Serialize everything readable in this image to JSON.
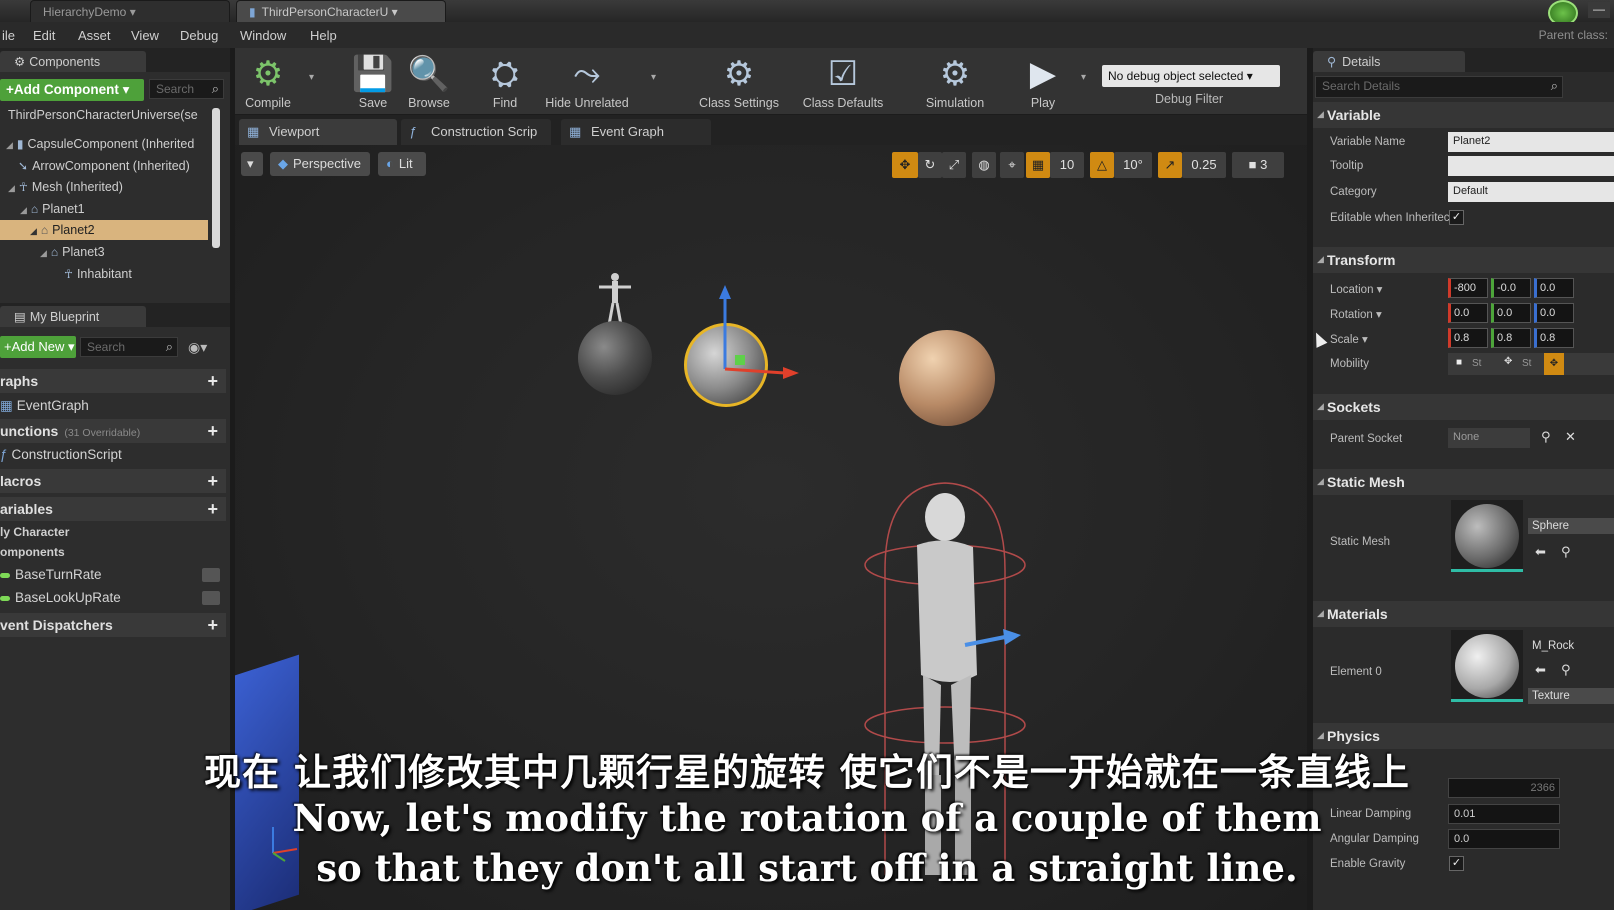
{
  "titlebar": {
    "tabs": [
      "HierarchyDemo",
      "ThirdPersonCharacterU"
    ],
    "parent_class": "Parent class: "
  },
  "menu": [
    "ile",
    "Edit",
    "Asset",
    "View",
    "Debug",
    "Window",
    "Help"
  ],
  "components": {
    "tab": "Components",
    "add_component": "+Add Component ▾",
    "search_placeholder": "Search",
    "root": "ThirdPersonCharacterUniverse(se",
    "tree": [
      {
        "label": "CapsuleComponent (Inherited"
      },
      {
        "label": "ArrowComponent (Inherited)"
      },
      {
        "label": "Mesh (Inherited)"
      },
      {
        "label": "Planet1"
      },
      {
        "label": "Planet2"
      },
      {
        "label": "Planet3"
      },
      {
        "label": "Inhabitant"
      }
    ]
  },
  "myblueprint": {
    "tab": "My Blueprint",
    "add_new": "+Add New ▾",
    "search_placeholder": "Search",
    "graphs_label": "raphs",
    "event_graph": "EventGraph",
    "functions_label": "unctions",
    "functions_note": "(31 Overridable)",
    "construction_script": "ConstructionScript",
    "macros_label": "lacros",
    "variables_label": "ariables",
    "cat_my_character": "ly Character",
    "cat_components": "omponents",
    "vars": [
      "BaseTurnRate",
      "BaseLookUpRate"
    ],
    "event_dispatchers": "vent Dispatchers"
  },
  "toolbar": {
    "compile": "Compile",
    "save": "Save",
    "browse": "Browse",
    "find": "Find",
    "hide_unrelated": "Hide Unrelated",
    "class_settings": "Class Settings",
    "class_defaults": "Class Defaults",
    "simulation": "Simulation",
    "play": "Play",
    "debug_select": "No debug object selected ▾",
    "debug_filter": "Debug Filter"
  },
  "editor_tabs": {
    "viewport": "Viewport",
    "construction": "Construction Scrip",
    "event_graph": "Event Graph"
  },
  "viewport": {
    "perspective": "Perspective",
    "lit": "Lit",
    "grid_snap": "10",
    "rot_snap": "10°",
    "scale_snap": "0.25",
    "cam_speed": "3"
  },
  "subtitles": {
    "chinese": "现在 让我们修改其中几颗行星的旋转 使它们不是一开始就在一条直线上",
    "english_1": "Now, let's modify the rotation of a couple of them",
    "english_2": "so that they don't all start off in a straight line."
  },
  "details": {
    "tab": "Details",
    "search_placeholder": "Search Details",
    "variable": {
      "section": "Variable",
      "name_label": "Variable Name",
      "name_value": "Planet2",
      "tooltip_label": "Tooltip",
      "category_label": "Category",
      "category_value": "Default",
      "editable_label": "Editable when Inheritec"
    },
    "transform": {
      "section": "Transform",
      "location_label": "Location ▾",
      "location": [
        "-800",
        "-0.0",
        "0.0"
      ],
      "rotation_label": "Rotation ▾",
      "rotation": [
        "0.0",
        "0.0",
        "0.0"
      ],
      "scale_label": "Scale ▾",
      "scale": [
        "0.8",
        "0.8",
        "0.8"
      ],
      "mobility_label": "Mobility",
      "mobility_opts": [
        "St",
        "St"
      ]
    },
    "sockets": {
      "section": "Sockets",
      "parent_label": "Parent Socket",
      "parent_value": "None"
    },
    "static_mesh": {
      "section": "Static Mesh",
      "label": "Static Mesh",
      "asset": "Sphere"
    },
    "materials": {
      "section": "Materials",
      "label": "Element 0",
      "asset": "M_Rock",
      "texture": "Texture"
    },
    "physics": {
      "section": "Physics",
      "field_partial": "2366",
      "linear_label": "Linear Damping",
      "linear_value": "0.01",
      "angular_label": "Angular Damping",
      "angular_value": "0.0",
      "gravity_label": "Enable Gravity"
    }
  }
}
